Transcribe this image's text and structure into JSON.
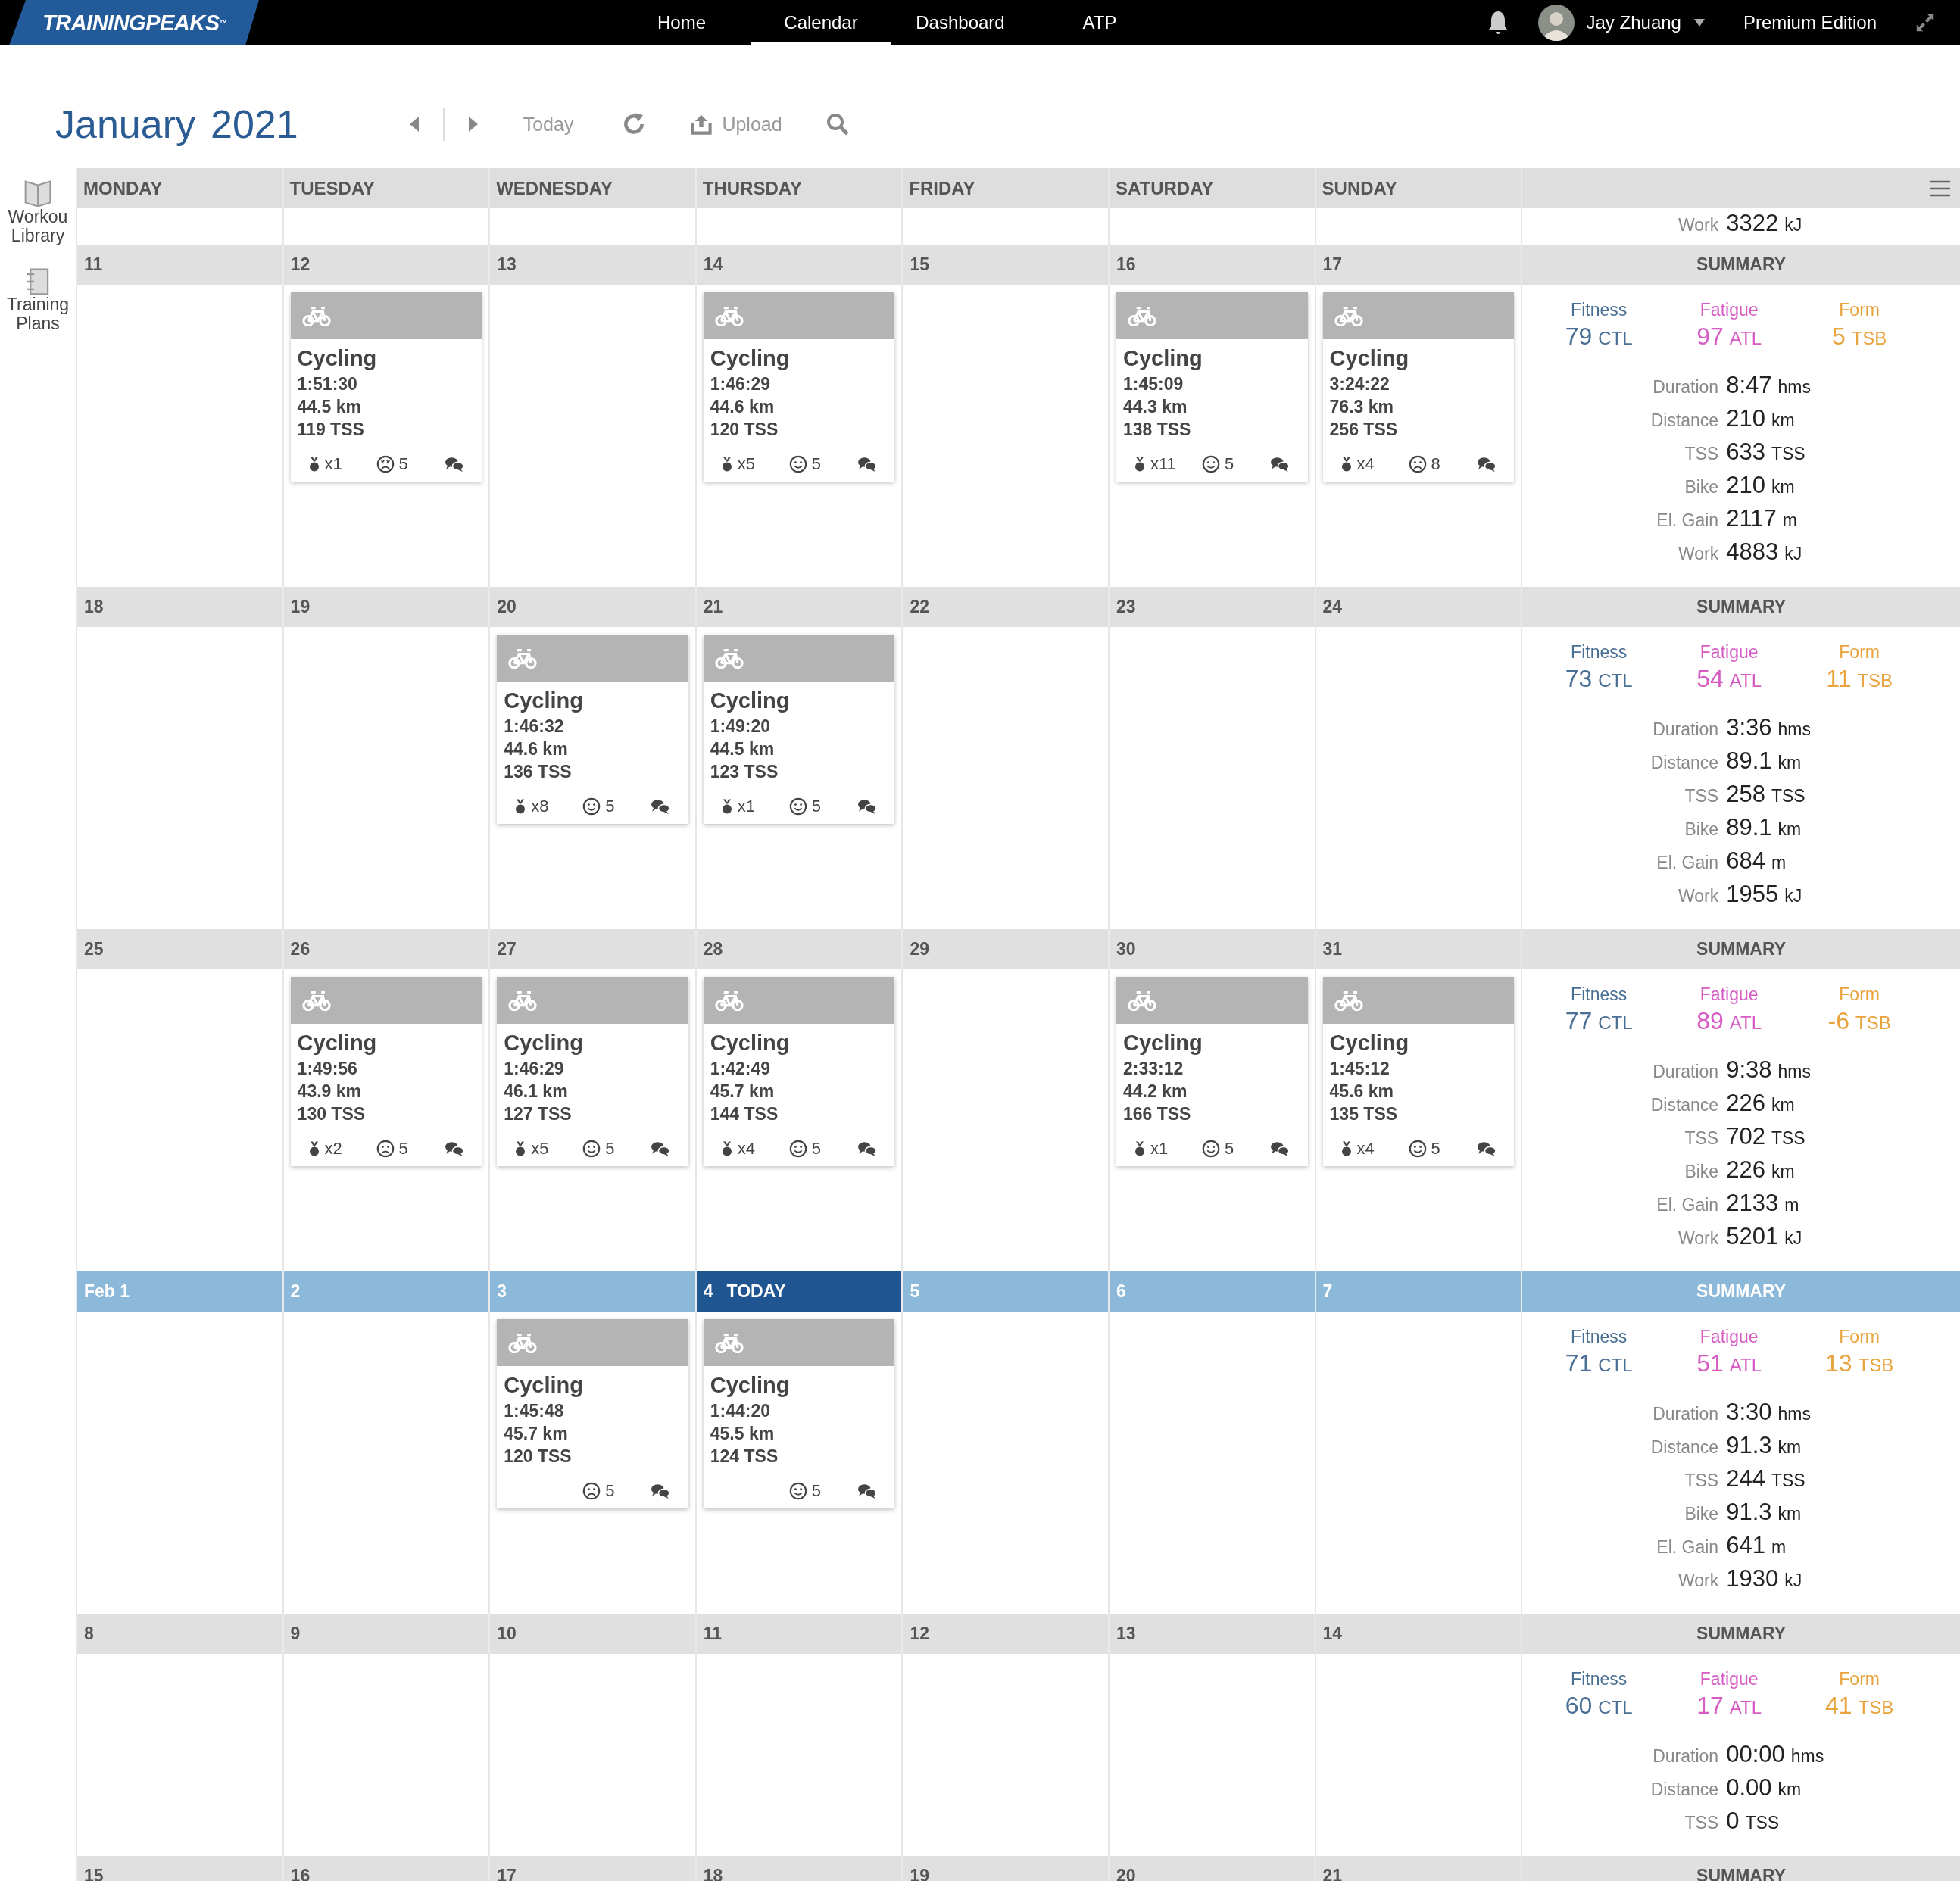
{
  "app": {
    "logo": "TRAININGPEAKS$^{™}$",
    "nav": [
      {
        "label": "Home",
        "selected": false
      },
      {
        "label": "Calendar",
        "selected": true
      },
      {
        "label": "Dashboard",
        "selected": false
      },
      {
        "label": "ATP",
        "selected": false
      }
    ],
    "user": {
      "name": "Jay Zhuang"
    },
    "edition": "Premium Edition"
  },
  "toolbar": {
    "month": "January",
    "year": "2021",
    "today": "Today",
    "upload": "Upload"
  },
  "sidebar": [
    {
      "kind": "library",
      "label": "Workou Library"
    },
    {
      "kind": "plans",
      "label": "Training Plans"
    }
  ],
  "weekdays": [
    "MONDAY",
    "TUESDAY",
    "WEDNESDAY",
    "THURSDAY",
    "FRIDAY",
    "SATURDAY",
    "SUNDAY"
  ],
  "carryover": {
    "label": "Work",
    "value": "3322",
    "unit": "kJ"
  },
  "weeks": [
    {
      "current": false,
      "days": [
        {
          "label": "11",
          "today": false
        },
        {
          "label": "12",
          "today": false,
          "workouts": [
            {
              "kind": "dizzy",
              "title": "Cycling",
              "duration": "1:51:30",
              "distance": "44.5 km",
              "tss": "119 TSS",
              "medals": "x1",
              "feel_value": "5"
            }
          ]
        },
        {
          "label": "13",
          "today": false
        },
        {
          "label": "14",
          "today": false,
          "workouts": [
            {
              "kind": "smile",
              "title": "Cycling",
              "duration": "1:46:29",
              "distance": "44.6 km",
              "tss": "120 TSS",
              "medals": "x5",
              "feel_value": "5"
            }
          ]
        },
        {
          "label": "15",
          "today": false
        },
        {
          "label": "16",
          "today": false,
          "workouts": [
            {
              "kind": "smile",
              "title": "Cycling",
              "duration": "1:45:09",
              "distance": "44.3 km",
              "tss": "138 TSS",
              "medals": "x11",
              "feel_value": "5"
            }
          ]
        },
        {
          "label": "17",
          "today": false,
          "workouts": [
            {
              "kind": "frown",
              "title": "Cycling",
              "duration": "3:24:22",
              "distance": "76.3 km",
              "tss": "256 TSS",
              "medals": "x4",
              "feel_value": "8"
            }
          ]
        }
      ],
      "summary": {
        "title": "SUMMARY",
        "metrics": [
          {
            "label": "Fitness",
            "value": "79",
            "unit": "CTL",
            "color": "#4a6f94"
          },
          {
            "label": "Fatigue",
            "value": "97",
            "unit": "ATL",
            "color": "#d65cc4"
          },
          {
            "label": "Form",
            "value": "5",
            "unit": "TSB",
            "color": "#e8a33c"
          }
        ],
        "stats": [
          {
            "label": "Duration",
            "value": "8:47",
            "unit": "hms"
          },
          {
            "label": "Distance",
            "value": "210",
            "unit": "km"
          },
          {
            "label": "TSS",
            "value": "633",
            "unit": "TSS"
          },
          {
            "label": "Bike",
            "value": "210",
            "unit": "km"
          },
          {
            "label": "El. Gain",
            "value": "2117",
            "unit": "m"
          },
          {
            "label": "Work",
            "value": "4883",
            "unit": "kJ"
          }
        ]
      }
    },
    {
      "current": false,
      "days": [
        {
          "label": "18",
          "today": false
        },
        {
          "label": "19",
          "today": false
        },
        {
          "label": "20",
          "today": false,
          "workouts": [
            {
              "kind": "smile",
              "title": "Cycling",
              "duration": "1:46:32",
              "distance": "44.6 km",
              "tss": "136 TSS",
              "medals": "x8",
              "feel_value": "5"
            }
          ]
        },
        {
          "label": "21",
          "today": false,
          "workouts": [
            {
              "kind": "smile",
              "title": "Cycling",
              "duration": "1:49:20",
              "distance": "44.5 km",
              "tss": "123 TSS",
              "medals": "x1",
              "feel_value": "5"
            }
          ]
        },
        {
          "label": "22",
          "today": false
        },
        {
          "label": "23",
          "today": false
        },
        {
          "label": "24",
          "today": false
        }
      ],
      "summary": {
        "title": "SUMMARY",
        "metrics": [
          {
            "label": "Fitness",
            "value": "73",
            "unit": "CTL",
            "color": "#4a6f94"
          },
          {
            "label": "Fatigue",
            "value": "54",
            "unit": "ATL",
            "color": "#d65cc4"
          },
          {
            "label": "Form",
            "value": "11",
            "unit": "TSB",
            "color": "#e8a33c"
          }
        ],
        "stats": [
          {
            "label": "Duration",
            "value": "3:36",
            "unit": "hms"
          },
          {
            "label": "Distance",
            "value": "89.1",
            "unit": "km"
          },
          {
            "label": "TSS",
            "value": "258",
            "unit": "TSS"
          },
          {
            "label": "Bike",
            "value": "89.1",
            "unit": "km"
          },
          {
            "label": "El. Gain",
            "value": "684",
            "unit": "m"
          },
          {
            "label": "Work",
            "value": "1955",
            "unit": "kJ"
          }
        ]
      }
    },
    {
      "current": false,
      "days": [
        {
          "label": "25",
          "today": false
        },
        {
          "label": "26",
          "today": false,
          "workouts": [
            {
              "kind": "frown",
              "title": "Cycling",
              "duration": "1:49:56",
              "distance": "43.9 km",
              "tss": "130 TSS",
              "medals": "x2",
              "feel_value": "5"
            }
          ]
        },
        {
          "label": "27",
          "today": false,
          "workouts": [
            {
              "kind": "smile",
              "title": "Cycling",
              "duration": "1:46:29",
              "distance": "46.1 km",
              "tss": "127 TSS",
              "medals": "x5",
              "feel_value": "5"
            }
          ]
        },
        {
          "label": "28",
          "today": false,
          "workouts": [
            {
              "kind": "smile",
              "title": "Cycling",
              "duration": "1:42:49",
              "distance": "45.7 km",
              "tss": "144 TSS",
              "medals": "x4",
              "feel_value": "5"
            }
          ]
        },
        {
          "label": "29",
          "today": false
        },
        {
          "label": "30",
          "today": false,
          "workouts": [
            {
              "kind": "smile",
              "title": "Cycling",
              "duration": "2:33:12",
              "distance": "44.2 km",
              "tss": "166 TSS",
              "medals": "x1",
              "feel_value": "5"
            }
          ]
        },
        {
          "label": "31",
          "today": false,
          "workouts": [
            {
              "kind": "smile",
              "title": "Cycling",
              "duration": "1:45:12",
              "distance": "45.6 km",
              "tss": "135 TSS",
              "medals": "x4",
              "feel_value": "5"
            }
          ]
        }
      ],
      "summary": {
        "title": "SUMMARY",
        "metrics": [
          {
            "label": "Fitness",
            "value": "77",
            "unit": "CTL",
            "color": "#4a6f94"
          },
          {
            "label": "Fatigue",
            "value": "89",
            "unit": "ATL",
            "color": "#d65cc4"
          },
          {
            "label": "Form",
            "value": "-6",
            "unit": "TSB",
            "color": "#e8a33c"
          }
        ],
        "stats": [
          {
            "label": "Duration",
            "value": "9:38",
            "unit": "hms"
          },
          {
            "label": "Distance",
            "value": "226",
            "unit": "km"
          },
          {
            "label": "TSS",
            "value": "702",
            "unit": "TSS"
          },
          {
            "label": "Bike",
            "value": "226",
            "unit": "km"
          },
          {
            "label": "El. Gain",
            "value": "2133",
            "unit": "m"
          },
          {
            "label": "Work",
            "value": "5201",
            "unit": "kJ"
          }
        ]
      }
    },
    {
      "current": true,
      "days": [
        {
          "label": "Feb 1",
          "today": false
        },
        {
          "label": "2",
          "today": false
        },
        {
          "label": "3",
          "today": false,
          "workouts": [
            {
              "kind": "frown",
              "title": "Cycling",
              "duration": "1:45:48",
              "distance": "45.7 km",
              "tss": "120 TSS",
              "feel_value": "5"
            }
          ]
        },
        {
          "label": "4",
          "today": true,
          "badge": "TODAY",
          "workouts": [
            {
              "kind": "smile",
              "title": "Cycling",
              "duration": "1:44:20",
              "distance": "45.5 km",
              "tss": "124 TSS",
              "feel_value": "5"
            }
          ]
        },
        {
          "label": "5",
          "today": false
        },
        {
          "label": "6",
          "today": false
        },
        {
          "label": "7",
          "today": false
        }
      ],
      "summary": {
        "title": "SUMMARY",
        "metrics": [
          {
            "label": "Fitness",
            "value": "71",
            "unit": "CTL",
            "color": "#4a6f94"
          },
          {
            "label": "Fatigue",
            "value": "51",
            "unit": "ATL",
            "color": "#d65cc4"
          },
          {
            "label": "Form",
            "value": "13",
            "unit": "TSB",
            "color": "#e8a33c"
          }
        ],
        "stats": [
          {
            "label": "Duration",
            "value": "3:30",
            "unit": "hms"
          },
          {
            "label": "Distance",
            "value": "91.3",
            "unit": "km"
          },
          {
            "label": "TSS",
            "value": "244",
            "unit": "TSS"
          },
          {
            "label": "Bike",
            "value": "91.3",
            "unit": "km"
          },
          {
            "label": "El. Gain",
            "value": "641",
            "unit": "m"
          },
          {
            "label": "Work",
            "value": "1930",
            "unit": "kJ"
          }
        ]
      }
    },
    {
      "current": false,
      "days": [
        {
          "label": "8",
          "today": false
        },
        {
          "label": "9",
          "today": false
        },
        {
          "label": "10",
          "today": false
        },
        {
          "label": "11",
          "today": false
        },
        {
          "label": "12",
          "today": false
        },
        {
          "label": "13",
          "today": false
        },
        {
          "label": "14",
          "today": false
        }
      ],
      "summary": {
        "title": "SUMMARY",
        "metrics": [
          {
            "label": "Fitness",
            "value": "60",
            "unit": "CTL",
            "color": "#4a6f94"
          },
          {
            "label": "Fatigue",
            "value": "17",
            "unit": "ATL",
            "color": "#d65cc4"
          },
          {
            "label": "Form",
            "value": "41",
            "unit": "TSB",
            "color": "#e8a33c"
          }
        ],
        "stats": [
          {
            "label": "Duration",
            "value": "00:00",
            "unit": "hms"
          },
          {
            "label": "Distance",
            "value": "0.00",
            "unit": "km"
          },
          {
            "label": "TSS",
            "value": "0",
            "unit": "TSS"
          }
        ]
      }
    },
    {
      "current": false,
      "days": [
        {
          "label": "15",
          "today": false
        },
        {
          "label": "16",
          "today": false
        },
        {
          "label": "17",
          "today": false
        },
        {
          "label": "18",
          "today": false
        },
        {
          "label": "19",
          "today": false
        },
        {
          "label": "20",
          "today": false
        },
        {
          "label": "21",
          "today": false
        }
      ],
      "summary": {
        "title": "SUMMARY"
      }
    }
  ]
}
